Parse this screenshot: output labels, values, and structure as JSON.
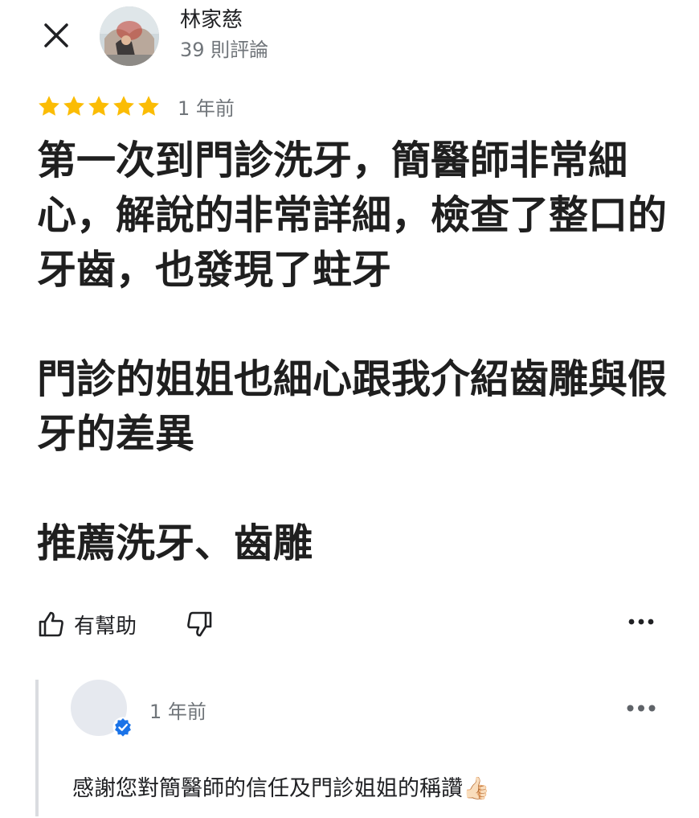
{
  "header": {
    "close_icon": "close-icon",
    "reviewer_name": "林家慈",
    "review_count": "39 則評論"
  },
  "review": {
    "rating": 5,
    "rating_max": 5,
    "star_color": "#fbbc04",
    "time": "1 年前",
    "paragraphs": [
      "第一次到門診洗牙，簡醫師非常細心，解說的非常詳細，檢查了整口的牙齒，也發現了蛀牙",
      "門診的姐姐也細心跟我介紹齒雕與假牙的差異",
      "推薦洗牙、齒雕"
    ]
  },
  "actions": {
    "helpful_icon": "thumbs-up-icon",
    "helpful_label": "有幫助",
    "not_helpful_icon": "thumbs-down-icon",
    "more_icon": "more-horizontal-icon"
  },
  "owner_reply": {
    "verified_icon": "verified-badge-icon",
    "verified_color": "#1a73e8",
    "time": "1 年前",
    "text": "感謝您對簡醫師的信任及門診姐姐的稱讚👍🏻",
    "more_icon": "more-horizontal-icon"
  }
}
